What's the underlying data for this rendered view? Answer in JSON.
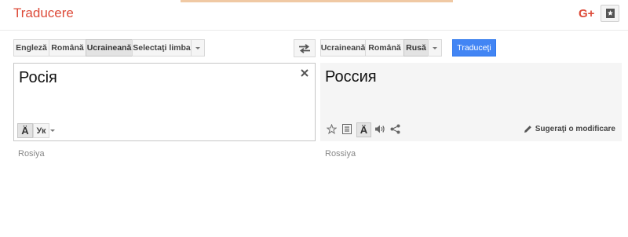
{
  "header": {
    "title": "Traducere",
    "gplus_label": "G+"
  },
  "source_langs": {
    "items": [
      "Engleză",
      "Română",
      "Ucraineană",
      "Selectaţi limba"
    ],
    "selected": "Ucraineană"
  },
  "target_langs": {
    "items": [
      "Ucraineană",
      "Română",
      "Rusă"
    ],
    "selected": "Rusă"
  },
  "translate_button": "Traduceţi",
  "source": {
    "text": "Росія",
    "keyboard_label": "Ук",
    "transliteration": "Rosiya"
  },
  "target": {
    "text": "Россия",
    "suggest_label": "Sugeraţi o modificare",
    "transliteration": "Rossiya"
  },
  "colors": {
    "brand": "#dd4b39",
    "translate_button_bg": "#4285f4"
  },
  "icons": [
    "gplus-icon",
    "bookmark-icon",
    "swap-icon",
    "clear-icon",
    "font-icon",
    "star-icon",
    "list-icon",
    "speaker-icon",
    "share-icon",
    "pencil-icon"
  ]
}
